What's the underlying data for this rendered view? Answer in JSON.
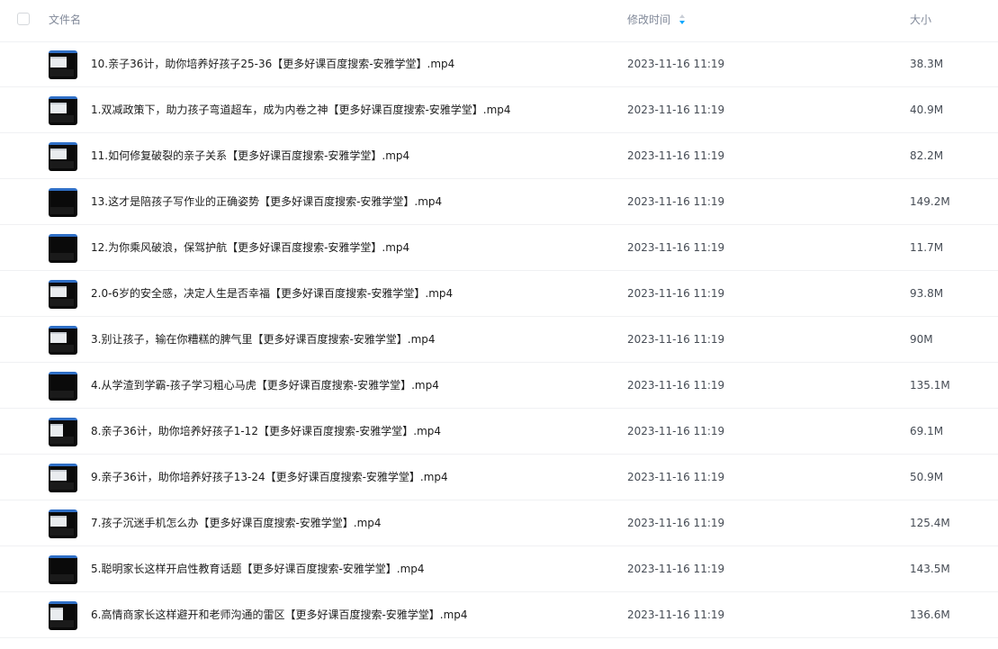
{
  "header": {
    "name_label": "文件名",
    "time_label": "修改时间",
    "size_label": "大小",
    "sort_icon": "sort-ascending-icon",
    "accent_color": "#06a7ff"
  },
  "files": [
    {
      "name": "10.亲子36计，助你培养好孩子25-36【更多好课百度搜索-安雅学堂】.mp4",
      "modified": "2023-11-16 11:19",
      "size": "38.3M",
      "thumb": "video-thumbnail-icon"
    },
    {
      "name": "1.双减政策下，助力孩子弯道超车，成为内卷之神【更多好课百度搜索-安雅学堂】.mp4",
      "modified": "2023-11-16 11:19",
      "size": "40.9M",
      "thumb": "video-thumbnail-icon"
    },
    {
      "name": "11.如何修复破裂的亲子关系【更多好课百度搜索-安雅学堂】.mp4",
      "modified": "2023-11-16 11:19",
      "size": "82.2M",
      "thumb": "video-thumbnail-icon"
    },
    {
      "name": "13.这才是陪孩子写作业的正确姿势【更多好课百度搜索-安雅学堂】.mp4",
      "modified": "2023-11-16 11:19",
      "size": "149.2M",
      "thumb": "video-thumbnail-icon"
    },
    {
      "name": "12.为你乘风破浪，保驾护航【更多好课百度搜索-安雅学堂】.mp4",
      "modified": "2023-11-16 11:19",
      "size": "11.7M",
      "thumb": "video-thumbnail-icon"
    },
    {
      "name": "2.0-6岁的安全感，决定人生是否幸福【更多好课百度搜索-安雅学堂】.mp4",
      "modified": "2023-11-16 11:19",
      "size": "93.8M",
      "thumb": "video-thumbnail-icon"
    },
    {
      "name": "3.别让孩子，输在你糟糕的脾气里【更多好课百度搜索-安雅学堂】.mp4",
      "modified": "2023-11-16 11:19",
      "size": "90M",
      "thumb": "video-thumbnail-icon"
    },
    {
      "name": "4.从学渣到学霸-孩子学习粗心马虎【更多好课百度搜索-安雅学堂】.mp4",
      "modified": "2023-11-16 11:19",
      "size": "135.1M",
      "thumb": "video-thumbnail-icon"
    },
    {
      "name": "8.亲子36计，助你培养好孩子1-12【更多好课百度搜索-安雅学堂】.mp4",
      "modified": "2023-11-16 11:19",
      "size": "69.1M",
      "thumb": "video-thumbnail-icon"
    },
    {
      "name": "9.亲子36计，助你培养好孩子13-24【更多好课百度搜索-安雅学堂】.mp4",
      "modified": "2023-11-16 11:19",
      "size": "50.9M",
      "thumb": "video-thumbnail-icon"
    },
    {
      "name": "7.孩子沉迷手机怎么办【更多好课百度搜索-安雅学堂】.mp4",
      "modified": "2023-11-16 11:19",
      "size": "125.4M",
      "thumb": "video-thumbnail-icon"
    },
    {
      "name": "5.聪明家长这样开启性教育话题【更多好课百度搜索-安雅学堂】.mp4",
      "modified": "2023-11-16 11:19",
      "size": "143.5M",
      "thumb": "video-thumbnail-icon"
    },
    {
      "name": "6.高情商家长这样避开和老师沟通的雷区【更多好课百度搜索-安雅学堂】.mp4",
      "modified": "2023-11-16 11:19",
      "size": "136.6M",
      "thumb": "video-thumbnail-icon"
    }
  ]
}
